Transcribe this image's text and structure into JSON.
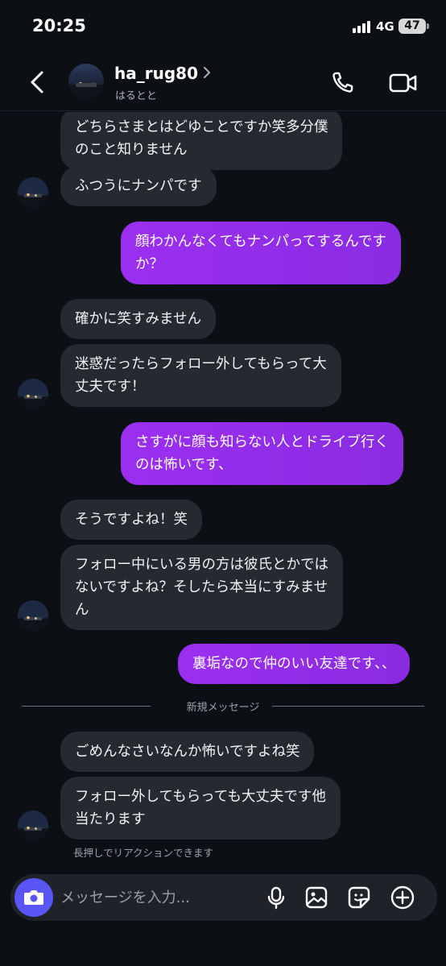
{
  "status": {
    "time": "20:25",
    "network": "4G",
    "battery": "47"
  },
  "header": {
    "username": "ha_rug80",
    "display_name": "はるとと"
  },
  "messages": [
    {
      "dir": "in",
      "text": "どちらさまとはどゆことですか笑多分僕\nのこと知りません"
    },
    {
      "dir": "in",
      "text": "ふつうにナンパです"
    },
    {
      "dir": "out",
      "text": "顔わかんなくてもナンパってするんです\nか？"
    },
    {
      "dir": "in",
      "text": "確かに笑すみません"
    },
    {
      "dir": "in",
      "text": "迷惑だったらフォロー外してもらって大\n丈夫です！"
    },
    {
      "dir": "out",
      "text": "さすがに顔も知らない人とドライブ行く\nのは怖いです、"
    },
    {
      "dir": "in",
      "text": "そうですよね！笑"
    },
    {
      "dir": "in",
      "text": "フォロー中にいる男の方は彼氏とかでは\nないですよね？そしたら本当にすみませ\nん"
    },
    {
      "dir": "out",
      "text": "裏垢なので仲のいい友達です、、"
    },
    {
      "dir": "in",
      "text": "ごめんなさいなんか怖いですよね笑"
    },
    {
      "dir": "in",
      "text": "フォロー外してもらっても大丈夫です他\n当たります"
    }
  ],
  "divider_label": "新規メッセージ",
  "reaction_hint": "長押しでリアクションできます",
  "composer": {
    "placeholder": "メッセージを入力..."
  },
  "colors": {
    "background": "#0c0f14",
    "incoming_bubble": "#262a30",
    "outgoing_bubble": "#9b2ff0",
    "camera_button": "#5a55f5"
  },
  "icons": [
    "back-arrow-icon",
    "chevron-right-icon",
    "phone-icon",
    "video-camera-icon",
    "camera-icon",
    "microphone-icon",
    "image-icon",
    "sticker-icon",
    "plus-icon"
  ]
}
